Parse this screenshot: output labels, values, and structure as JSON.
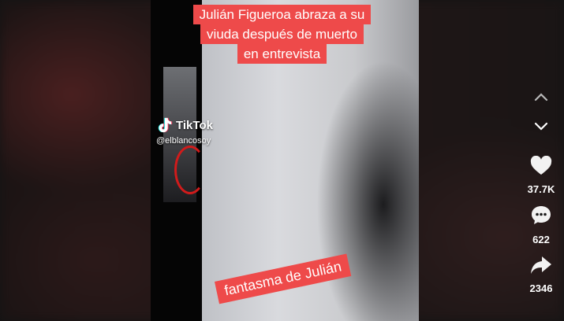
{
  "watermark": {
    "brand": "TikTok",
    "handle": "@elblancosoy"
  },
  "headline": {
    "lines": [
      "Julián Figueroa abraza a su",
      "viuda después de muerto",
      "en entrevista"
    ]
  },
  "banner": {
    "text": "fantasma de Julián"
  },
  "rail": {
    "up_icon": "chevron-up-icon",
    "down_icon": "chevron-down-icon",
    "likes": "37.7K",
    "comments": "622",
    "shares": "2346"
  },
  "colors": {
    "caption_bg": "#ee4a4a",
    "circle_marker": "#d11b1b"
  }
}
